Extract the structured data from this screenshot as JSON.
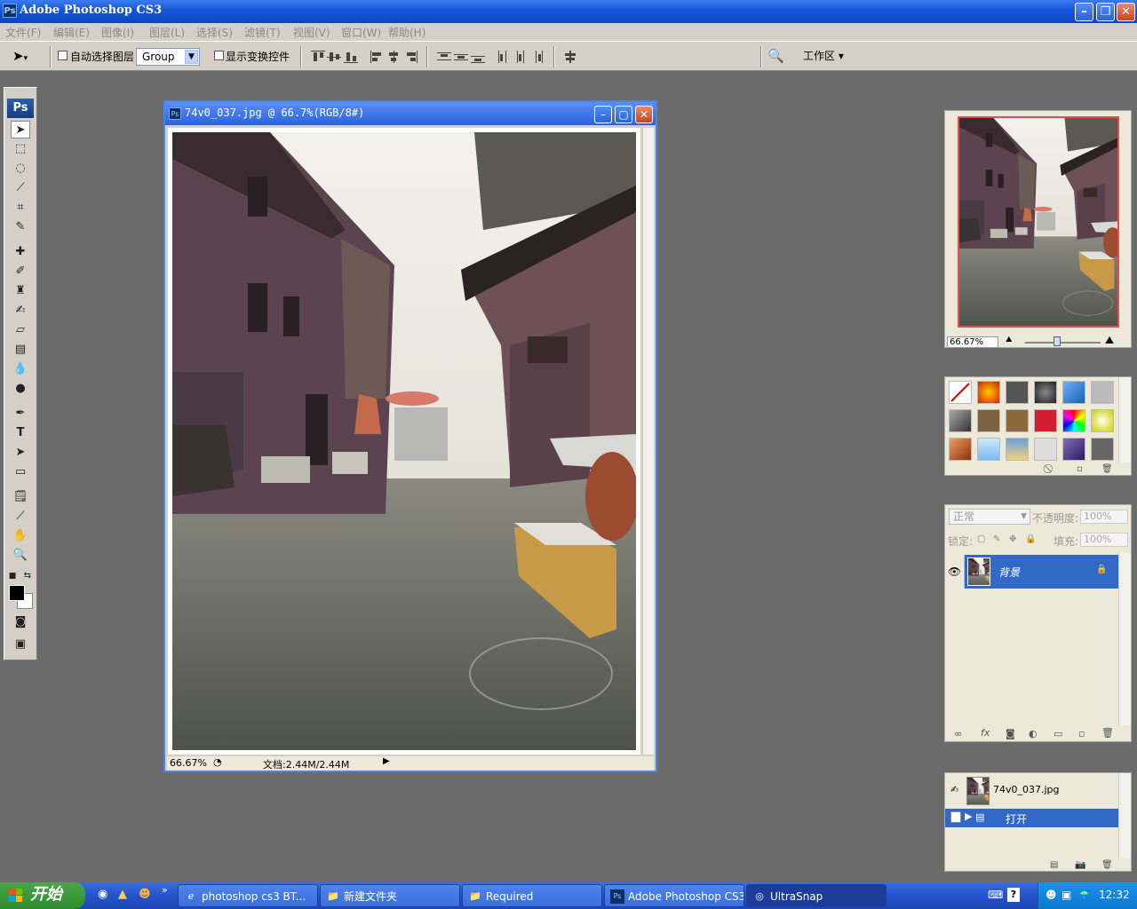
{
  "app": {
    "title": "Adobe Photoshop CS3"
  },
  "menu": [
    "文件(F)",
    "编辑(E)",
    "图像(I)",
    "图层(L)",
    "选择(S)",
    "滤镜(T)",
    "视图(V)",
    "窗口(W)",
    "帮助(H)"
  ],
  "options": {
    "auto_select_label": "自动选择图层",
    "auto_select_value": "Group",
    "show_transform_label": "显示变换控件",
    "workspace_label": "工作区 ▾"
  },
  "document": {
    "title": "74v0_037.jpg @ 66.7%(RGB/8#)",
    "zoom": "66.67%",
    "doc_info": "文档:2.44M/2.44M"
  },
  "navigator": {
    "zoom": "66.67%"
  },
  "layers": {
    "blend_mode": "正常",
    "opacity_label": "不透明度:",
    "opacity_value": "100%",
    "lock_label": "锁定:",
    "fill_label": "填充:",
    "fill_value": "100%",
    "layer_name": "背景"
  },
  "history": {
    "snapshot_name": "74v0_037.jpg",
    "step_label": "打开"
  },
  "taskbar": {
    "start_label": "开始",
    "items": [
      {
        "label": "photoshop cs3 BT...",
        "icon": "ie-icon"
      },
      {
        "label": "新建文件夹",
        "icon": "folder-icon"
      },
      {
        "label": "Required",
        "icon": "folder-icon"
      },
      {
        "label": "Adobe Photoshop CS3",
        "icon": "ps-icon"
      },
      {
        "label": "UltraSnap",
        "icon": "camera-icon"
      }
    ],
    "clock": "12:32"
  }
}
